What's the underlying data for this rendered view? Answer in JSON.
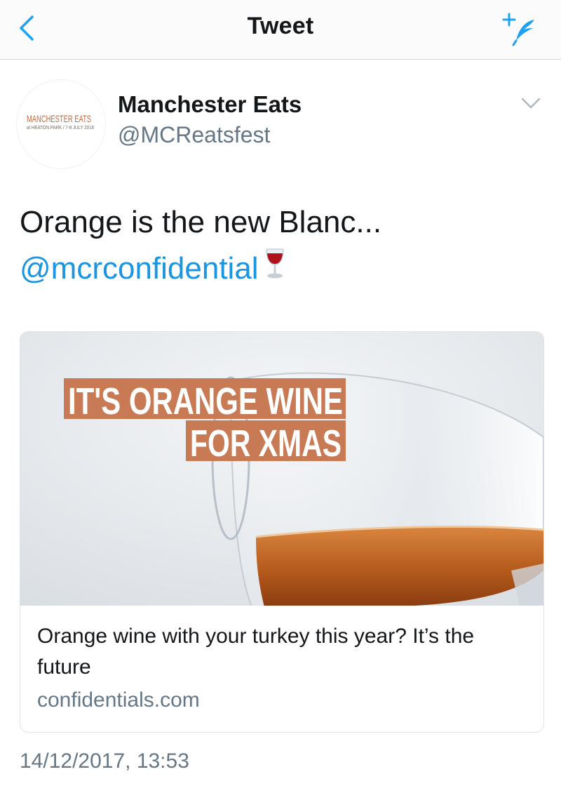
{
  "nav": {
    "title": "Tweet",
    "back_icon": "chevron-left-icon",
    "compose_icon": "compose-tweet-icon",
    "accent": "#1da1f2"
  },
  "author": {
    "display_name": "Manchester Eats",
    "handle": "@MCReatsfest",
    "avatar_logo": "MANCHESTER EATS",
    "avatar_sub": "at HEATON PARK / 7-8 JULY 2018"
  },
  "tweet": {
    "text": "Orange is the new Blanc...",
    "mention": "@mcrconfidential",
    "emoji_icon": "wine-glass-icon"
  },
  "card": {
    "image_banner_line1": "IT'S ORANGE WINE",
    "image_banner_line2": "FOR XMAS",
    "title": "Orange wine with your turkey this year? It’s the future",
    "domain": "confidentials.com",
    "banner_color": "#c87a55"
  },
  "timestamp": "14/12/2017, 13:53",
  "colors": {
    "link": "#1b95e0",
    "secondary_text": "#657786",
    "primary_text": "#14171a"
  }
}
